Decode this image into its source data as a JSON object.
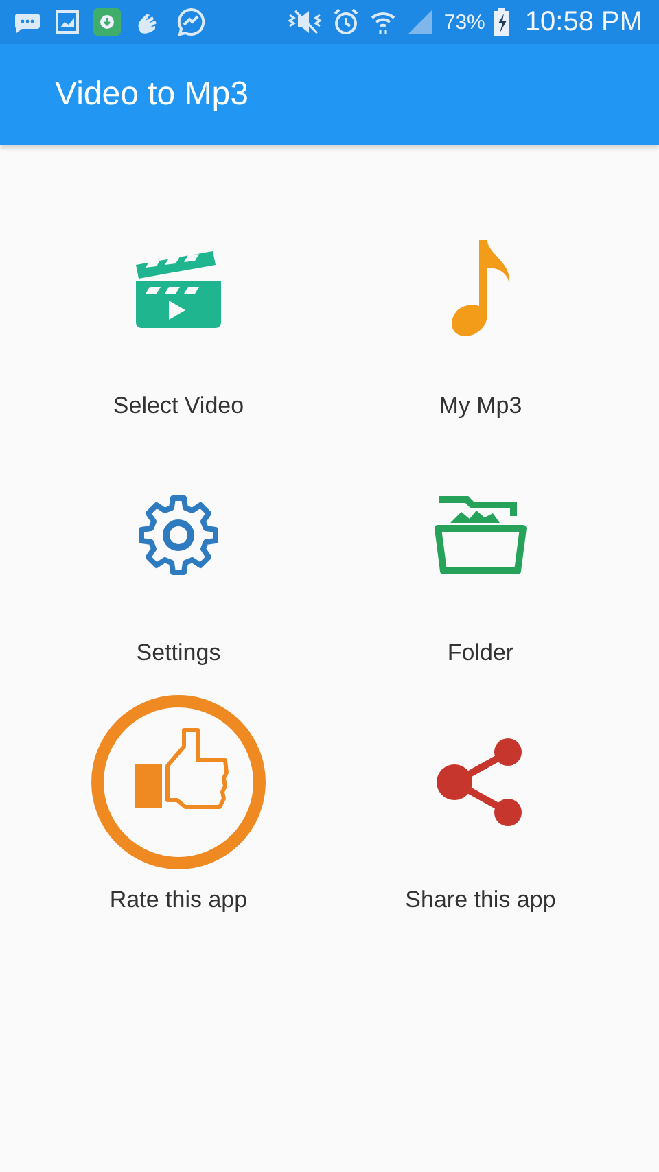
{
  "status_bar": {
    "battery": "73%",
    "time": "10:58 PM"
  },
  "app_bar": {
    "title": "Video to Mp3"
  },
  "items": [
    {
      "kind": "clapper",
      "label": "Select Video"
    },
    {
      "kind": "note",
      "label": "My Mp3"
    },
    {
      "kind": "gear",
      "label": "Settings"
    },
    {
      "kind": "folder",
      "label": "Folder"
    },
    {
      "kind": "like",
      "label": "Rate this app"
    },
    {
      "kind": "share",
      "label": "Share this app"
    }
  ]
}
